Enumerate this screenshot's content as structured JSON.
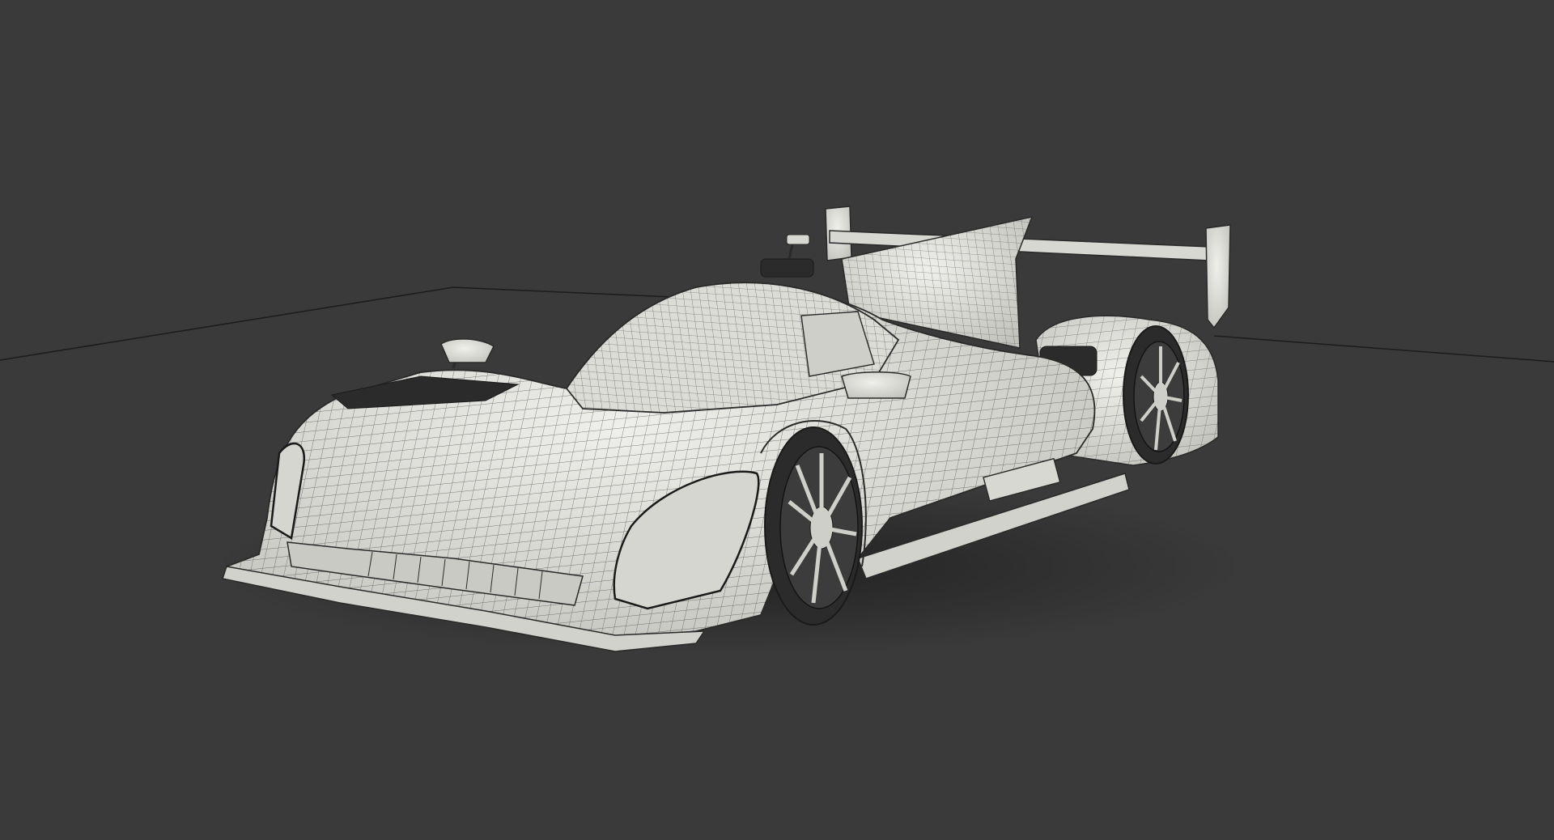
{
  "scene": {
    "background_color": "#3a3a3a",
    "ground_grid_color": "#1c1c1c",
    "body_fill": "#e6e6e2",
    "body_shade": "#c9c9c4",
    "wire_color": "#2a2a2a",
    "tire_color": "#2b2b2b",
    "shadow_color": "#222222",
    "subject": "car-wireframe-render"
  }
}
